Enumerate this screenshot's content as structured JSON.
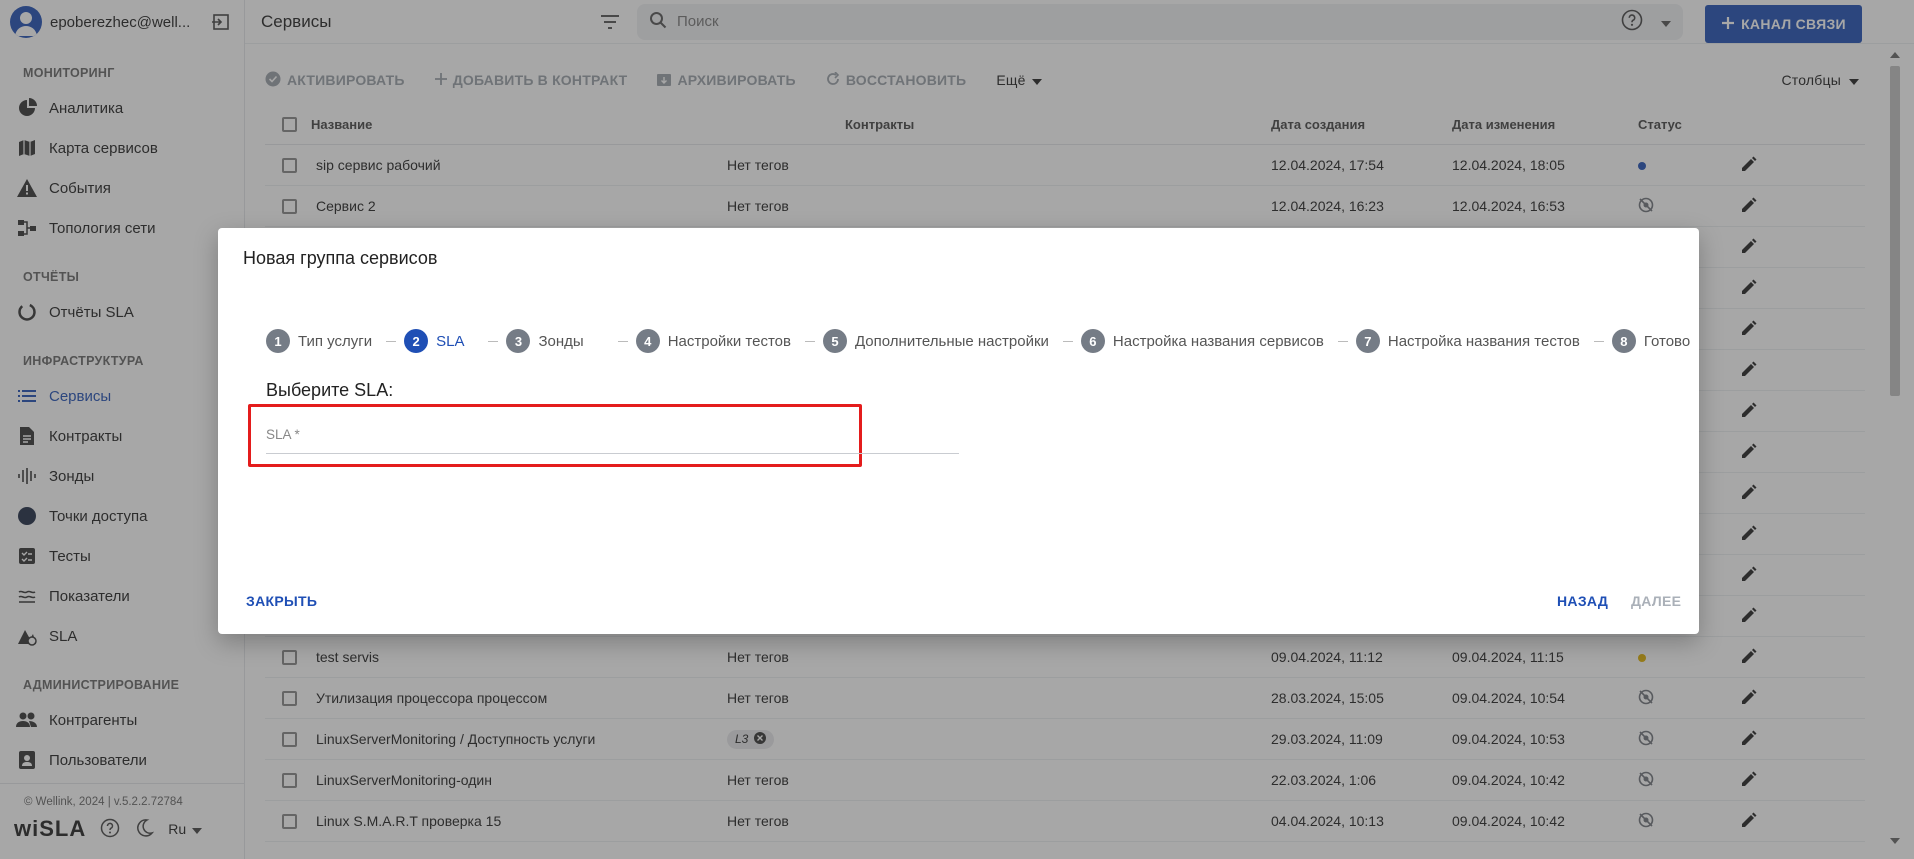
{
  "user": {
    "email": "epoberezhec@well..."
  },
  "sidebar": {
    "sections": [
      {
        "title": "МОНИТОРИНГ",
        "items": [
          {
            "label": "Аналитика",
            "icon": "pie-chart-icon"
          },
          {
            "label": "Карта сервисов",
            "icon": "map-icon"
          },
          {
            "label": "События",
            "icon": "warning-icon"
          },
          {
            "label": "Топология сети",
            "icon": "network-icon"
          }
        ]
      },
      {
        "title": "ОТЧЁТЫ",
        "items": [
          {
            "label": "Отчёты SLA",
            "icon": "report-icon"
          }
        ]
      },
      {
        "title": "ИНФРАСТРУКТУРА",
        "items": [
          {
            "label": "Сервисы",
            "icon": "list-icon",
            "active": true
          },
          {
            "label": "Контракты",
            "icon": "document-icon"
          },
          {
            "label": "Зонды",
            "icon": "probe-icon"
          },
          {
            "label": "Точки доступа",
            "icon": "access-point-icon"
          },
          {
            "label": "Тесты",
            "icon": "tests-icon"
          },
          {
            "label": "Показатели",
            "icon": "metrics-icon"
          },
          {
            "label": "SLA",
            "icon": "sla-icon"
          }
        ]
      },
      {
        "title": "АДМИНИСТРИРОВАНИЕ",
        "items": [
          {
            "label": "Контрагенты",
            "icon": "people-icon"
          },
          {
            "label": "Пользователи",
            "icon": "user-icon"
          }
        ]
      }
    ],
    "copyright": "© Wellink, 2024 | v.5.2.2.72784",
    "logo": "wiSLA",
    "language": "Ru"
  },
  "topbar": {
    "title": "Сервисы",
    "search_placeholder": "Поиск",
    "channel_button": "КАНАЛ СВЯЗИ"
  },
  "toolbar": {
    "activate": "АКТИВИРОВАТЬ",
    "add_to_contract": "ДОБАВИТЬ В КОНТРАКТ",
    "archive": "АРХИВИРОВАТЬ",
    "restore": "ВОССТАНОВИТЬ",
    "more": "Ещё",
    "columns": "Столбцы"
  },
  "table": {
    "headers": {
      "name": "Название",
      "contracts": "Контракты",
      "created": "Дата создания",
      "changed": "Дата изменения",
      "status": "Статус"
    },
    "rows": [
      {
        "name": "sip сервис рабочий",
        "tag": "Нет тегов",
        "created": "12.04.2024, 17:54",
        "changed": "12.04.2024, 18:05",
        "status": "active"
      },
      {
        "name": "Сервис 2",
        "tag": "Нет тегов",
        "created": "12.04.2024, 16:23",
        "changed": "12.04.2024, 16:53",
        "status": "disabled"
      },
      {
        "name": "",
        "tag": "",
        "created": "",
        "changed": "",
        "status": ""
      },
      {
        "name": "",
        "tag": "",
        "created": "",
        "changed": "",
        "status": ""
      },
      {
        "name": "",
        "tag": "",
        "created": "",
        "changed": "",
        "status": ""
      },
      {
        "name": "",
        "tag": "",
        "created": "",
        "changed": "",
        "status": ""
      },
      {
        "name": "",
        "tag": "",
        "created": "",
        "changed": "",
        "status": ""
      },
      {
        "name": "",
        "tag": "",
        "created": "",
        "changed": "",
        "status": ""
      },
      {
        "name": "",
        "tag": "",
        "created": "",
        "changed": "",
        "status": ""
      },
      {
        "name": "",
        "tag": "",
        "created": "",
        "changed": "",
        "status": ""
      },
      {
        "name": "",
        "tag": "",
        "created": "",
        "changed": "",
        "status": ""
      },
      {
        "name": "",
        "tag": "",
        "created": "",
        "changed": "",
        "status": ""
      },
      {
        "name": "test servis",
        "tag": "Нет тегов",
        "created": "09.04.2024, 11:12",
        "changed": "09.04.2024, 11:15",
        "status": "warning"
      },
      {
        "name": "Утилизация процессора процессом",
        "tag": "Нет тегов",
        "created": "28.03.2024, 15:05",
        "changed": "09.04.2024, 10:54",
        "status": "disabled"
      },
      {
        "name": "LinuxServerMonitoring / Доступность услуги",
        "tag": "L3",
        "tag_chip": true,
        "created": "29.03.2024, 11:09",
        "changed": "09.04.2024, 10:53",
        "status": "disabled"
      },
      {
        "name": "LinuxServerMonitoring-один",
        "tag": "Нет тегов",
        "created": "22.03.2024, 1:06",
        "changed": "09.04.2024, 10:42",
        "status": "disabled"
      },
      {
        "name": "Linux S.M.A.R.T проверка 15",
        "tag": "Нет тегов",
        "created": "04.04.2024, 10:13",
        "changed": "09.04.2024, 10:42",
        "status": "disabled"
      }
    ]
  },
  "status_colors": {
    "active": "#1f4fb5",
    "warning": "#e0b100",
    "disabled": "#6f747b"
  },
  "modal": {
    "title": "Новая группа сервисов",
    "steps": [
      {
        "num": "1",
        "label": "Тип услуги"
      },
      {
        "num": "2",
        "label": "SLA",
        "active": true
      },
      {
        "num": "3",
        "label": "Зонды"
      },
      {
        "num": "4",
        "label": "Настройки тестов"
      },
      {
        "num": "5",
        "label": "Дополнительные настройки"
      },
      {
        "num": "6",
        "label": "Настройка названия сервисов"
      },
      {
        "num": "7",
        "label": "Настройка названия тестов"
      },
      {
        "num": "8",
        "label": "Готово"
      }
    ],
    "section_label": "Выберите SLA:",
    "sla_field_placeholder": "SLA *",
    "close_button": "ЗАКРЫТЬ",
    "back_button": "НАЗАД",
    "next_button": "ДАЛЕЕ"
  }
}
